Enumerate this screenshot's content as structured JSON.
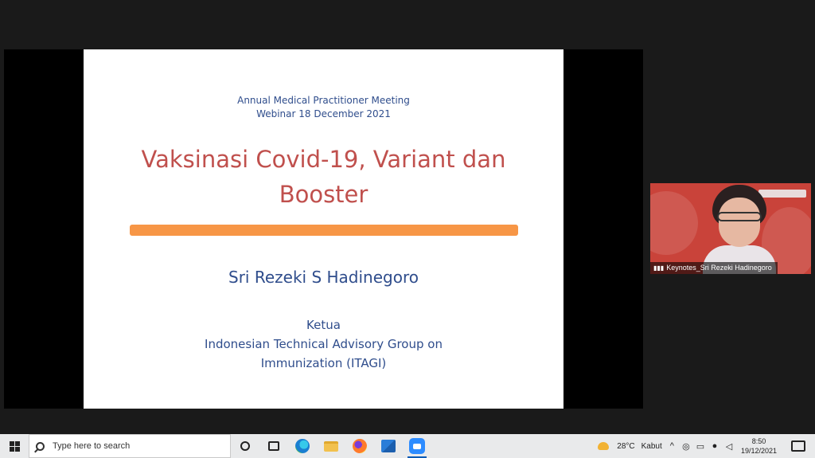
{
  "slide": {
    "meeting_name": "Annual Medical Practitioner Meeting",
    "webinar_date": "Webinar 18 December 2021",
    "title_line1": "Vaksinasi Covid-19, Variant dan",
    "title_line2": "Booster",
    "presenter": "Sri Rezeki S Hadinegoro",
    "role": "Ketua",
    "org_line1": "Indonesian Technical Advisory Group on",
    "org_line2": "Immunization (ITAGI)"
  },
  "video_tile": {
    "participant_name": "Keynotes_Sri Rezeki Hadinegoro",
    "signal_icon": "signal-bars-icon"
  },
  "taskbar": {
    "search_placeholder": "Type here to search",
    "weather_temp": "28°C",
    "weather_desc": "Kabut",
    "time": "8:50",
    "date": "19/12/2021",
    "chevron": "^"
  },
  "colors": {
    "slide_title": "#c0504d",
    "slide_text": "#2f4d8c",
    "accent_bar": "#f79646",
    "video_bg": "#c9433a",
    "taskbar_bg": "#e9eaeb"
  }
}
